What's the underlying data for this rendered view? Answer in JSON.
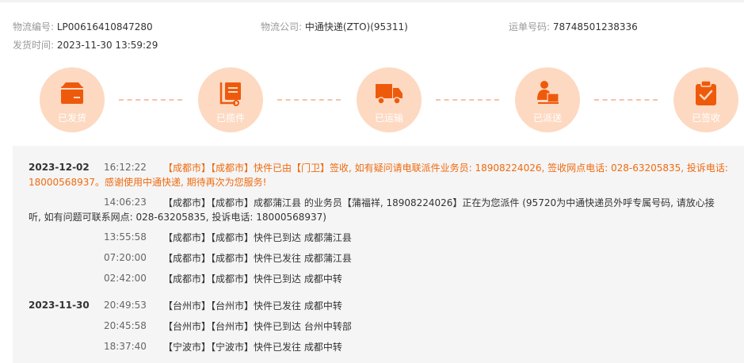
{
  "header": {
    "tracking_no_label": "物流编号:",
    "tracking_no": "LP00616410847280",
    "company_label": "物流公司:",
    "company": "中通快递(ZTO)(95311)",
    "waybill_label": "运单号码:",
    "waybill": "78748501238336",
    "ship_time_label": "发货时间:",
    "ship_time": "2023-11-30 13:59:29"
  },
  "steps": [
    {
      "label": "已发货",
      "icon": "package-icon"
    },
    {
      "label": "已揽件",
      "icon": "ledger-icon"
    },
    {
      "label": "已运输",
      "icon": "truck-icon"
    },
    {
      "label": "已派送",
      "icon": "courier-icon"
    },
    {
      "label": "已签收",
      "icon": "clipboard-check-icon"
    }
  ],
  "colors": {
    "accent": "#f06a0f",
    "circle": "#fdd9c2",
    "icon": "#ee5a0c",
    "dash": "#f5c4a4"
  },
  "timeline": {
    "day1": {
      "date": "2023-12-02",
      "e1": {
        "time": "16:12:22",
        "line1": "【成都市】【成都市】快件已由【门卫】签收, 如有疑问请电联派件业务员: 18908224026, 签收网点电话: 028-63205835, 投诉电话:",
        "line2": "18000568937。感谢使用中通快递, 期待再次为您服务!"
      },
      "e2": {
        "time": "14:06:23",
        "line1": "【成都市】【成都市】成都蒲江县 的业务员【蒲福祥, 18908224026】正在为您派件 (95720为中通快递员外呼专属号码, 请放心接",
        "line2": "听, 如有问题可联系网点: 028-63205835, 投诉电话: 18000568937)"
      },
      "e3": {
        "time": "13:55:58",
        "text": "【成都市】【成都市】快件已到达 成都蒲江县"
      },
      "e4": {
        "time": "07:20:00",
        "text": "【成都市】【成都市】快件已发往 成都蒲江县"
      },
      "e5": {
        "time": "02:42:00",
        "text": "【成都市】【成都市】快件已到达 成都中转"
      }
    },
    "day2": {
      "date": "2023-11-30",
      "e1": {
        "time": "20:49:53",
        "text": "【台州市】【台州市】快件已发往 成都中转"
      },
      "e2": {
        "time": "20:45:58",
        "text": "【台州市】【台州市】快件已到达 台州中转部"
      },
      "e3": {
        "time": "18:37:40",
        "text": "【宁波市】【宁波市】快件已发往 成都中转"
      }
    }
  }
}
